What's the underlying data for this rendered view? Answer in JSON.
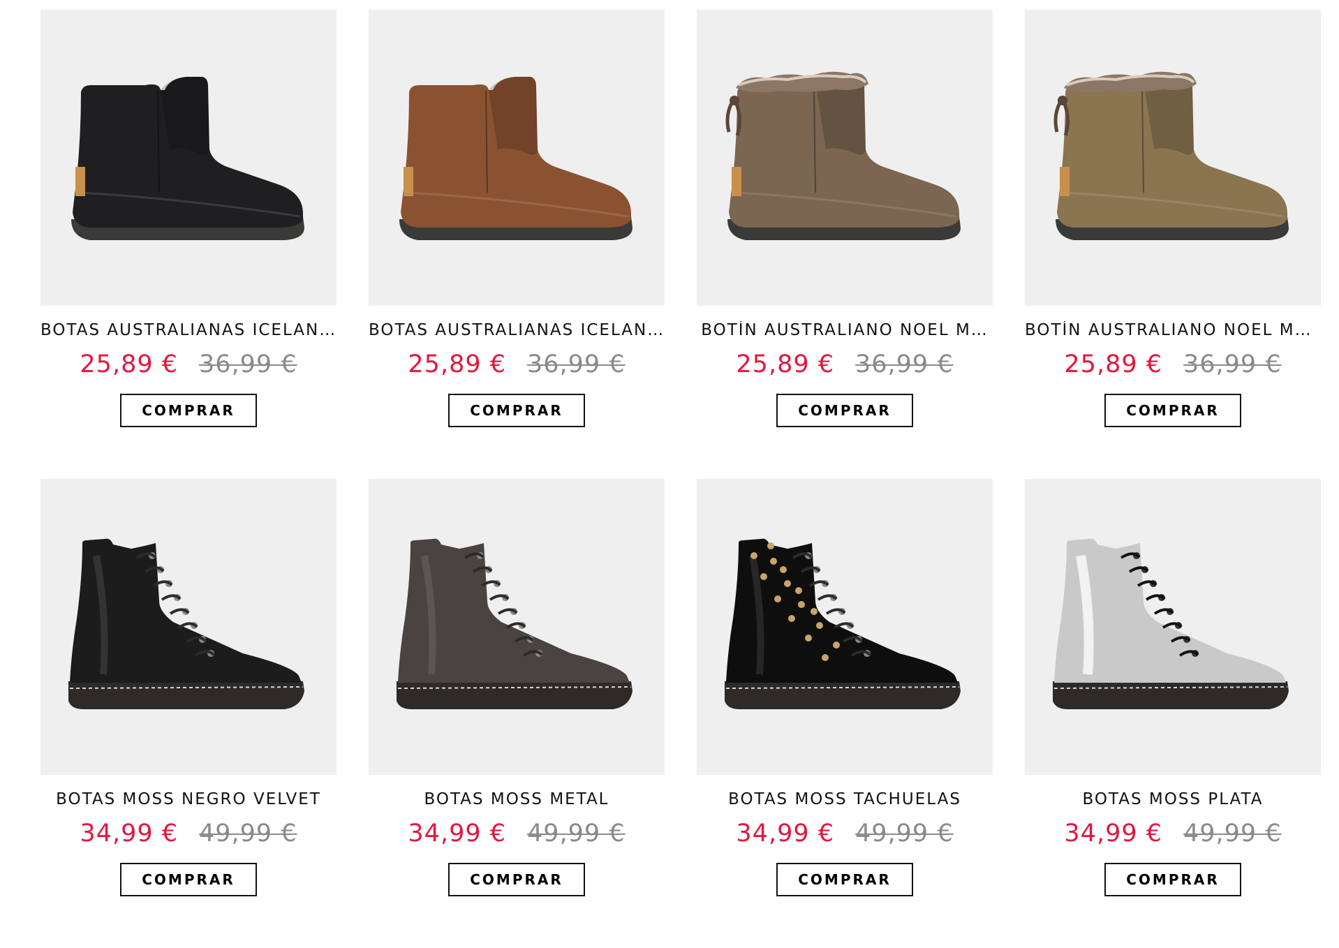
{
  "products": [
    {
      "name": "BOTAS AUSTRALIANAS ICELAN…",
      "price": "25,89 €",
      "old_price": "36,99 €",
      "button": "COMPRAR",
      "color": "#1f1f21",
      "type": "ugg",
      "fur": false
    },
    {
      "name": "BOTAS AUSTRALIANAS ICELAN…",
      "price": "25,89 €",
      "old_price": "36,99 €",
      "button": "COMPRAR",
      "color": "#8b5231",
      "type": "ugg",
      "fur": false
    },
    {
      "name": "BOTÍN AUSTRALIANO NOEL M…",
      "price": "25,89 €",
      "old_price": "36,99 €",
      "button": "COMPRAR",
      "color": "#7a6651",
      "type": "ugg",
      "fur": true
    },
    {
      "name": "BOTÍN AUSTRALIANO NOEL ME…",
      "price": "25,89 €",
      "old_price": "36,99 €",
      "button": "COMPRAR",
      "color": "#8a7550",
      "type": "ugg",
      "fur": true
    },
    {
      "name": "BOTAS MOSS NEGRO VELVET",
      "price": "34,99 €",
      "old_price": "49,99 €",
      "button": "COMPRAR",
      "color": "#1c1c1c",
      "type": "combat"
    },
    {
      "name": "BOTAS MOSS METAL",
      "price": "34,99 €",
      "old_price": "49,99 €",
      "button": "COMPRAR",
      "color": "#4a4340",
      "type": "combat"
    },
    {
      "name": "BOTAS MOSS TACHUELAS",
      "price": "34,99 €",
      "old_price": "49,99 €",
      "button": "COMPRAR",
      "color": "#0e0e0e",
      "type": "combat",
      "studs": true
    },
    {
      "name": "BOTAS MOSS PLATA",
      "price": "34,99 €",
      "old_price": "49,99 €",
      "button": "COMPRAR",
      "color": "#c9c9c9",
      "type": "combat"
    }
  ]
}
